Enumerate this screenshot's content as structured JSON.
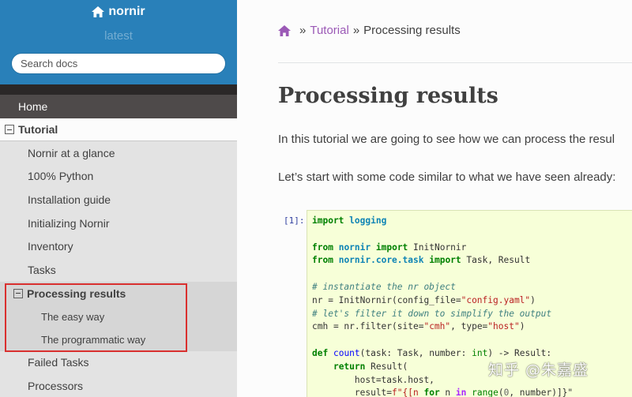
{
  "sidebar": {
    "project_name": "nornir",
    "version": "latest",
    "search_placeholder": "Search docs",
    "home_label": "Home",
    "tutorial_label": "Tutorial",
    "tutorial_items": [
      {
        "label": "Nornir at a glance"
      },
      {
        "label": "100% Python"
      },
      {
        "label": "Installation guide"
      },
      {
        "label": "Initializing Nornir"
      },
      {
        "label": "Inventory"
      },
      {
        "label": "Tasks"
      }
    ],
    "processing_label": "Processing results",
    "processing_items": [
      {
        "label": "The easy way"
      },
      {
        "label": "The programmatic way"
      }
    ],
    "after_items": [
      {
        "label": "Failed Tasks"
      },
      {
        "label": "Processors"
      }
    ],
    "colors": {
      "header": "#2980b9",
      "highlight_box": "#d9302f"
    }
  },
  "breadcrumbs": {
    "home_icon": "home-icon",
    "separator": "»",
    "parent": "Tutorial",
    "current": "Processing results"
  },
  "main": {
    "title": "Processing results",
    "para1": "In this tutorial we are going to see how we can process the resul",
    "para2": "Let’s start with some code similar to what we have seen already:",
    "cell_prompt": "[1]:"
  },
  "code": {
    "l1_kw": "import",
    "l1_mod": "logging",
    "l3_from": "from",
    "l3_mod": "nornir",
    "l3_imp": "import",
    "l3_rest": " InitNornir",
    "l4_from": "from",
    "l4_mod": "nornir.core.task",
    "l4_imp": "import",
    "l4_rest": " Task, Result",
    "l6_comment": "# instantiate the nr object",
    "l7_pre": "nr = InitNornir(config_file=",
    "l7_str": "\"config.yaml\"",
    "l7_post": ")",
    "l8_comment": "# let's filter it down to simplify the output",
    "l9_pre": "cmh = nr.filter(site=",
    "l9_str1": "\"cmh\"",
    "l9_mid": ", type=",
    "l9_str2": "\"host\"",
    "l9_post": ")",
    "l11_def": "def",
    "l11_fn": "count",
    "l11_a": "(task: Task, number: ",
    "l11_int": "int",
    "l11_b": ") -> Result:",
    "l12_indent": "    ",
    "l12_ret": "return",
    "l12_rest": " Result(",
    "l13": "        host=task.host,",
    "l14_pre": "        result=",
    "l14_str1": "f\"{[n ",
    "l14_for": "for",
    "l14_mid": " n ",
    "l14_in": "in",
    "l14_sp": " ",
    "l14_range": "range",
    "l14_args": "(",
    "l14_zero": "0",
    "l14_end": ", number)]}\""
  },
  "watermark": "知乎 @朱嘉盛"
}
